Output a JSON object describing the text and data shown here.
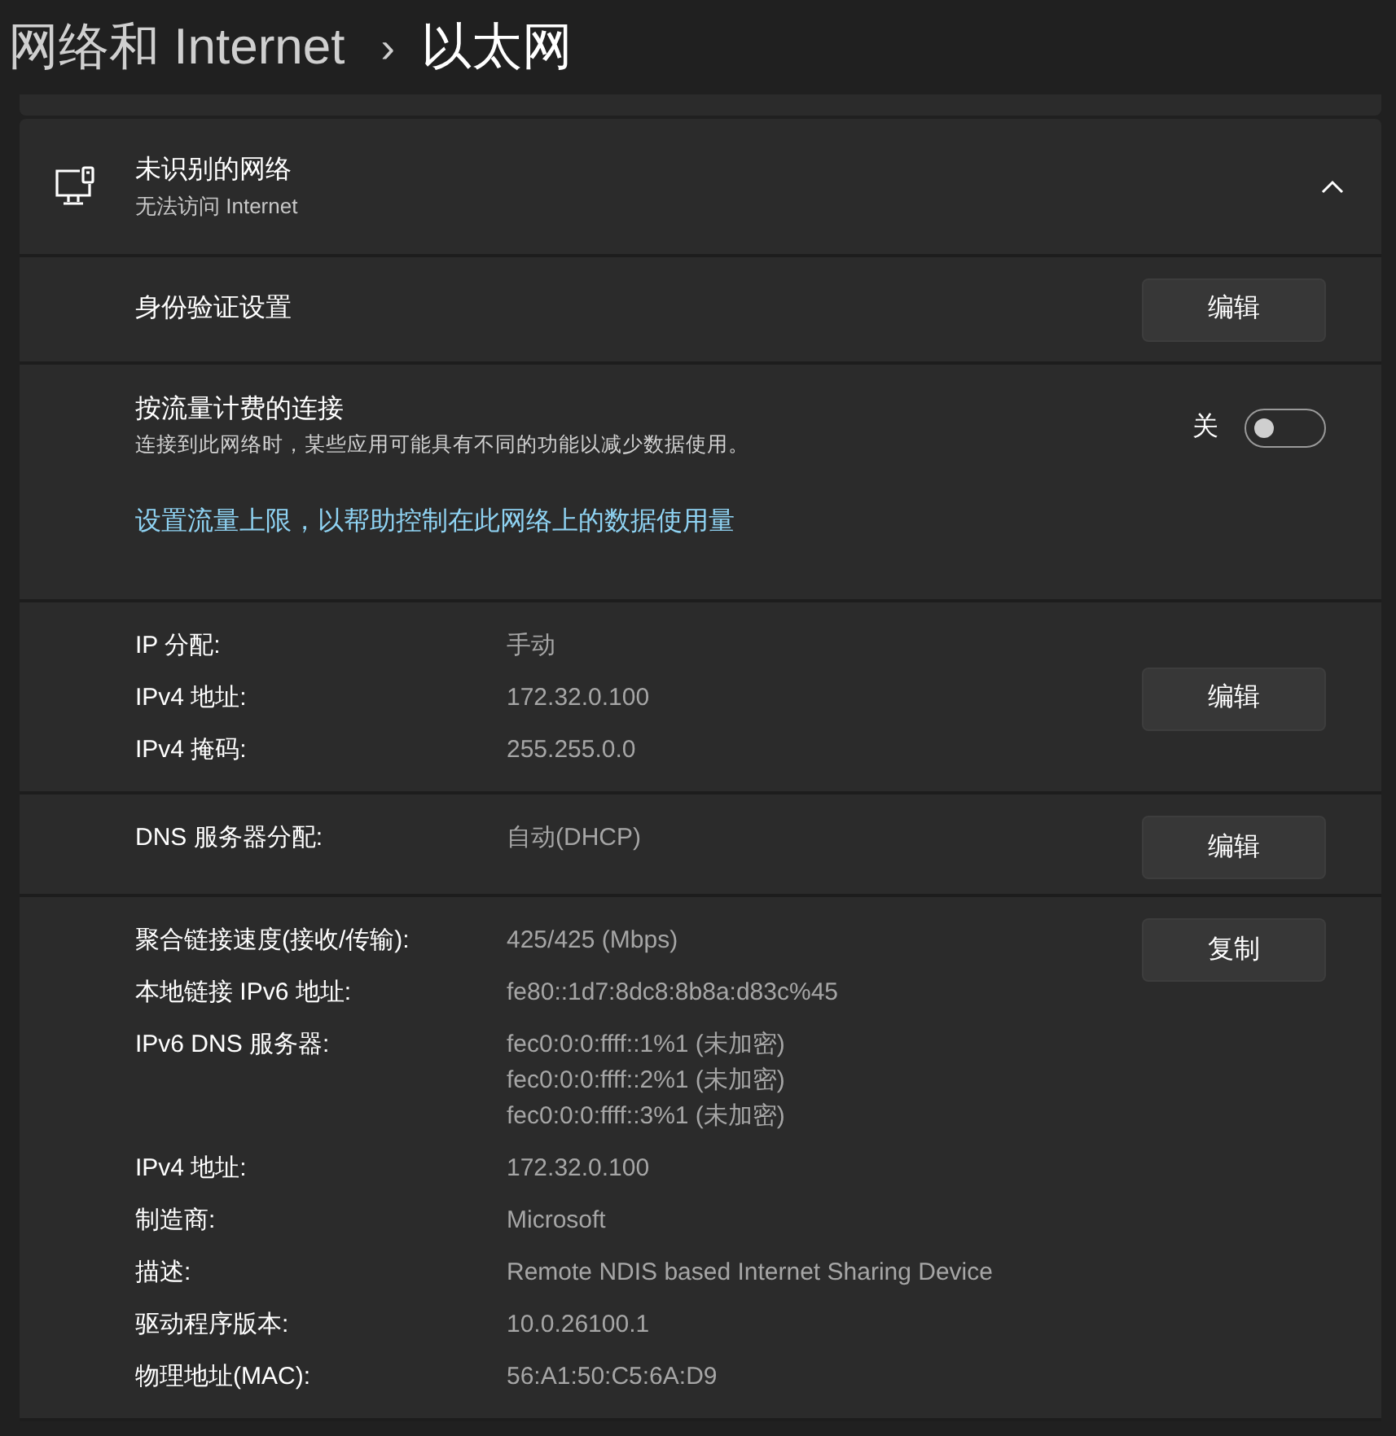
{
  "breadcrumb": {
    "parent": "网络和 Internet",
    "separator": "›",
    "current": "以太网"
  },
  "network": {
    "title": "未识别的网络",
    "subtitle": "无法访问 Internet",
    "expanded": true
  },
  "auth": {
    "label": "身份验证设置",
    "button": "编辑"
  },
  "metered": {
    "title": "按流量计费的连接",
    "description": "连接到此网络时，某些应用可能具有不同的功能以减少数据使用。",
    "state_label": "关",
    "on": false,
    "link": "设置流量上限，以帮助控制在此网络上的数据使用量"
  },
  "sections": [
    {
      "button": "编辑",
      "rows": [
        {
          "label": "IP 分配:",
          "values": [
            "手动"
          ]
        },
        {
          "label": "IPv4 地址:",
          "values": [
            "172.32.0.100"
          ]
        },
        {
          "label": "IPv4 掩码:",
          "values": [
            "255.255.0.0"
          ]
        }
      ]
    },
    {
      "button": "编辑",
      "rows": [
        {
          "label": "DNS 服务器分配:",
          "values": [
            "自动(DHCP)"
          ]
        }
      ]
    },
    {
      "button": "复制",
      "rows": [
        {
          "label": "聚合链接速度(接收/传输):",
          "values": [
            "425/425 (Mbps)"
          ]
        },
        {
          "label": "本地链接 IPv6 地址:",
          "values": [
            "fe80::1d7:8dc8:8b8a:d83c%45"
          ]
        },
        {
          "label": "IPv6 DNS 服务器:",
          "values": [
            "fec0:0:0:ffff::1%1 (未加密)",
            "fec0:0:0:ffff::2%1 (未加密)",
            "fec0:0:0:ffff::3%1 (未加密)"
          ]
        },
        {
          "label": "IPv4 地址:",
          "values": [
            "172.32.0.100"
          ]
        },
        {
          "label": "制造商:",
          "values": [
            "Microsoft"
          ]
        },
        {
          "label": "描述:",
          "values": [
            "Remote NDIS based Internet Sharing Device"
          ]
        },
        {
          "label": "驱动程序版本:",
          "values": [
            "10.0.26100.1"
          ]
        },
        {
          "label": "物理地址(MAC):",
          "values": [
            "56:A1:50:C5:6A:D9"
          ]
        }
      ]
    }
  ]
}
